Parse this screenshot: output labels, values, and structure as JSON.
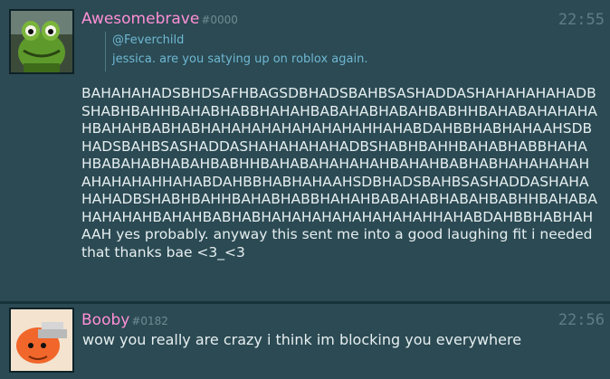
{
  "messages": [
    {
      "username": "Awesomebrave",
      "discriminator": "#0000",
      "time": "22:55",
      "reply_to": "@Feverchild",
      "reply_text": "jessica. are you satying up on roblox again.",
      "text": "BAHAHAHADSBHDSAFHBAGSDBHADSBAHBSASHADDASHAHAHAHAHADBSHABHBAHHBAHABHABBHAHAHBABAHABHABAHBABHHBAHABAHAHAHAHBAHAHBABHABHAHAHAHAHAHAHAHAHHAHABDAHBBHABHAHAAHSDBHADSBAHBSASHADDASHAHAHAHAHADBSHABHBAHHBAHABHABBHAHAHBABAHABHABAHBABHHBAHABAHAHAHAHBAHAHBABHABHAHAHAHAHAHAHAHAHHAHABDAHBBHABHAHAAHSDBHADSBAHBSASHADDASHAHAHAHADBSHABHBAHHBAHABHABBHAHAHBABAHABHABAHBABHHBAHABAHAHAHAHBAHAHBABHABHAHAHAHAHAHAHAHAHHAHABDAHBBHABHAHAAH yes probably. anyway this sent me into a good laughing fit i needed that thanks bae <3_<3",
      "avatar_icon": "frog-avatar"
    },
    {
      "username": "Booby",
      "discriminator": "#0182",
      "time": "22:56",
      "text": "wow you really are crazy i think im blocking you everywhere",
      "avatar_icon": "chainsaw-dog-avatar"
    }
  ]
}
